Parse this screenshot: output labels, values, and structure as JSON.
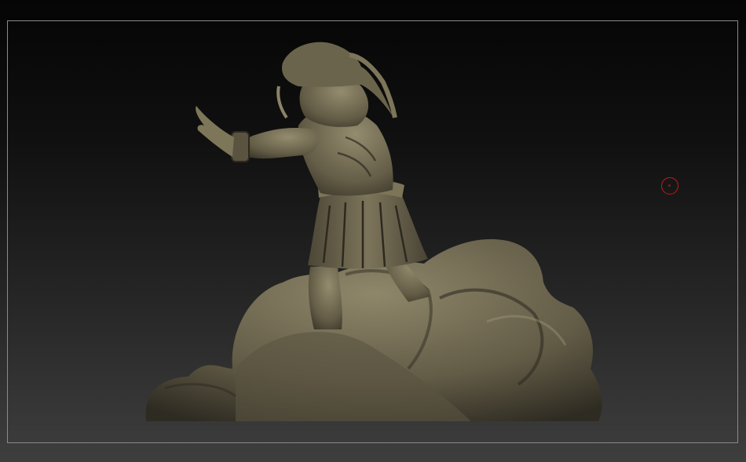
{
  "app": {
    "name": "",
    "view": "sculpt-viewport"
  },
  "viewport": {
    "background_top": "#050505",
    "background_bottom": "#3e3e3e",
    "frame_color": "#8a8a8a"
  },
  "model": {
    "description_icon": "sculpted-figure",
    "material_base": "#6b634c",
    "material_highlight": "#9a9274",
    "material_shadow": "#2a2720"
  },
  "cursor": {
    "icon": "brush-circle-cursor",
    "color": "#c41a1a"
  }
}
